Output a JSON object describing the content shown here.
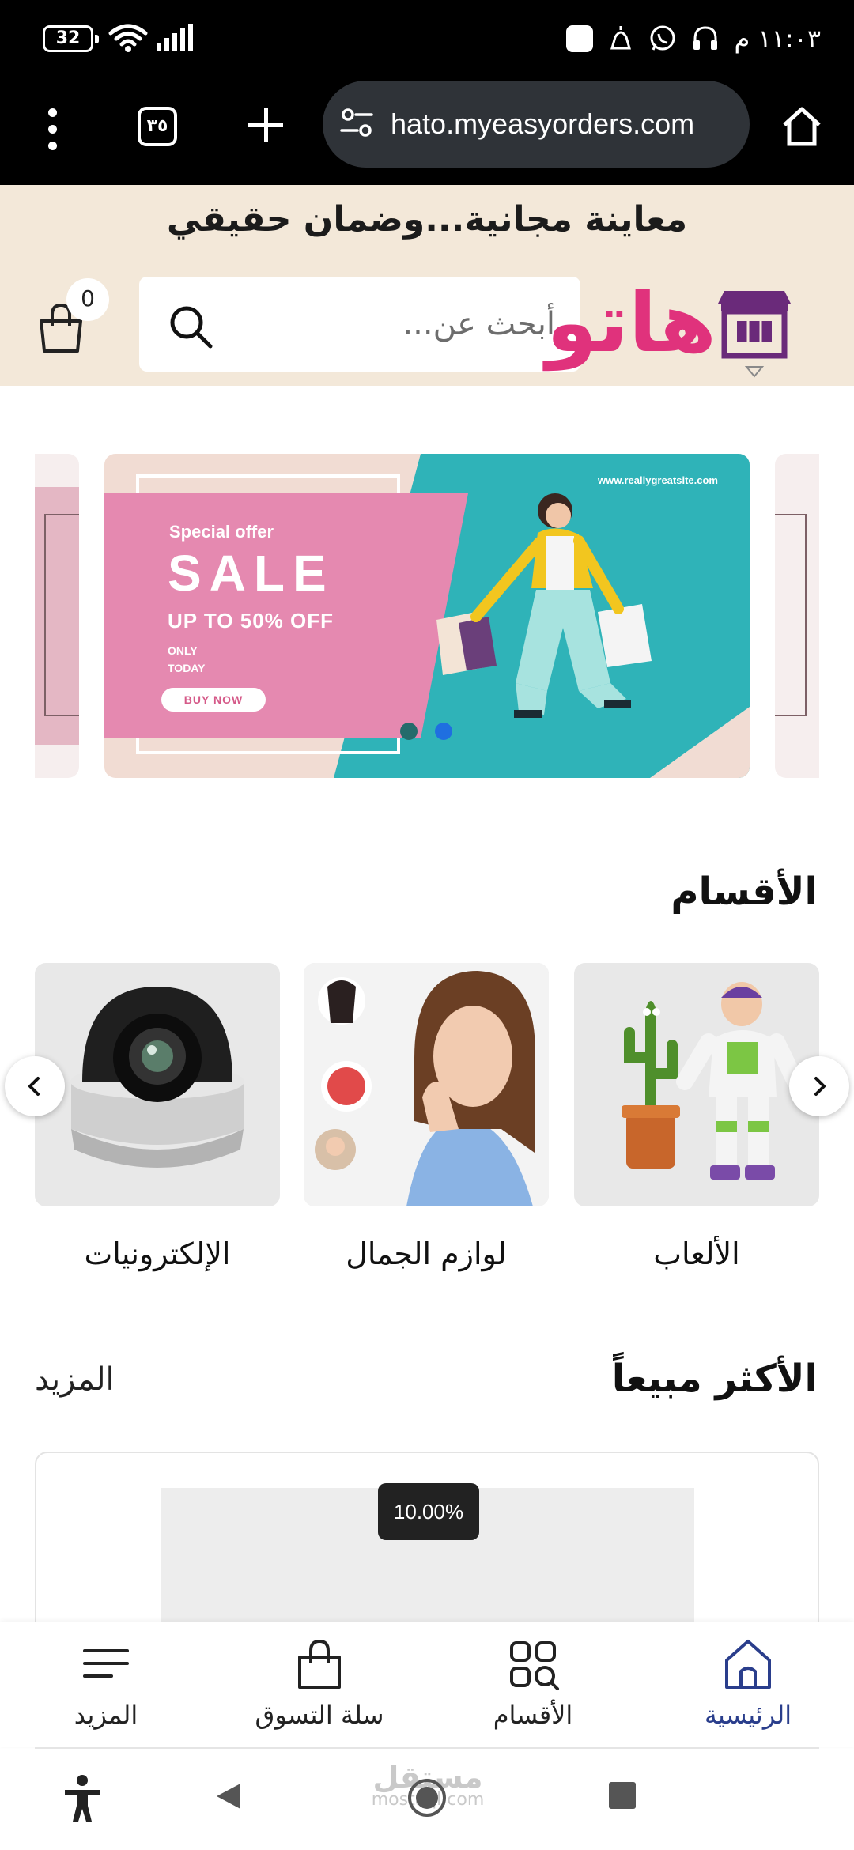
{
  "status_bar": {
    "battery": "32",
    "time": "١١:٠٣ م"
  },
  "browser": {
    "tab_count": "٣٥",
    "url": "hato.myeasyorders.com"
  },
  "header": {
    "tagline": "معاينة مجانية...وضمان حقيقي",
    "logo_text": "هاتو",
    "cart_count": "0",
    "search_placeholder": "أبحث عن..."
  },
  "banner": {
    "special": "Special offer",
    "sale": "SALE",
    "upto": "UP TO 50% OFF",
    "only": "ONLY",
    "today": "TODAY",
    "buy_now": "BUY NOW",
    "site": "www.reallygreatsite.com",
    "active_slide": 2,
    "slide_count": 2
  },
  "categories": {
    "title": "الأقسام",
    "items": [
      {
        "label": "الألعاب"
      },
      {
        "label": "لوازم الجمال"
      },
      {
        "label": "الإلكترونيات"
      }
    ]
  },
  "best_sellers": {
    "title": "الأكثر مبيعاً",
    "more": "المزيد",
    "products": [
      {
        "discount": "10.00%"
      }
    ]
  },
  "bottom_nav": {
    "items": [
      {
        "label": "الرئيسية",
        "icon": "home-icon",
        "active": true
      },
      {
        "label": "الأقسام",
        "icon": "categories-icon"
      },
      {
        "label": "سلة التسوق",
        "icon": "shopping-bag-icon"
      },
      {
        "label": "المزيد",
        "icon": "menu-icon"
      }
    ]
  },
  "watermark": {
    "arabic": "مستقل",
    "latin": "mostaql.com"
  },
  "colors": {
    "header_bg": "#f3e8d9",
    "logo_pink": "#e0327c",
    "logo_purple": "#6a2a7a",
    "banner_pink": "#e589b0",
    "banner_teal": "#2fb3b8",
    "active_nav": "#2a3e8c"
  }
}
